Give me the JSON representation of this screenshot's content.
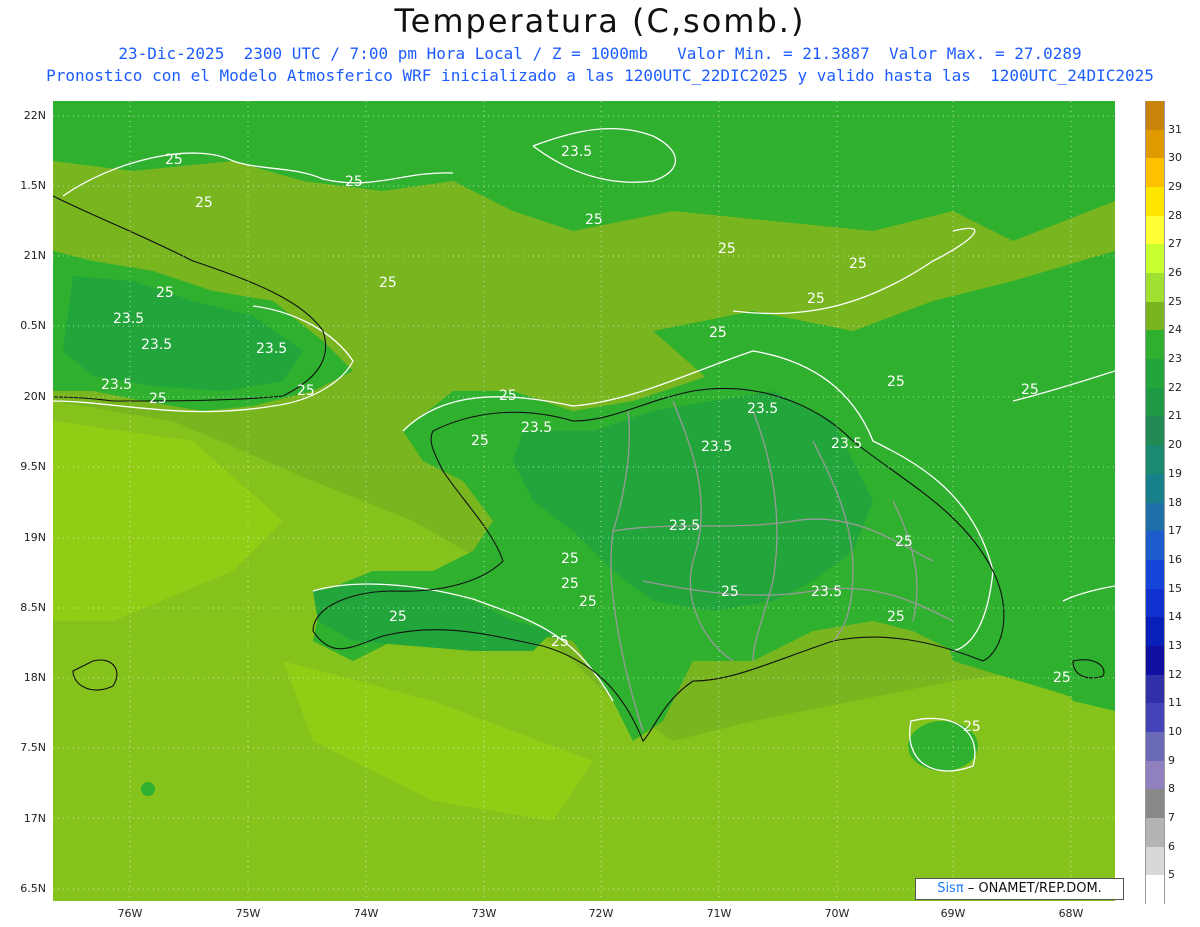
{
  "title": "Temperatura (C,somb.)",
  "subtitle1": "23-Dic-2025  2300 UTC / 7:00 pm Hora Local / Z = 1000mb   Valor Min. = 21.3887  Valor Max. = 27.0289",
  "subtitle2": "Pronostico con el Modelo Atmosferico WRF inicializado a las 1200UTC_22DIC2025 y valido hasta las  1200UTC_24DIC2025",
  "credit": {
    "brand": "Sisπ",
    "text": " – ONAMET/REP.DOM."
  },
  "lat_labels": [
    "22N",
    "1.5N",
    "21N",
    "0.5N",
    "20N",
    "9.5N",
    "19N",
    "8.5N",
    "18N",
    "7.5N",
    "17N",
    "6.5N"
  ],
  "lon_labels": [
    "76W",
    "75W",
    "74W",
    "73W",
    "72W",
    "71W",
    "70W",
    "69W",
    "68W"
  ],
  "contour_labels": [
    "25",
    "23.5"
  ],
  "colorbar": {
    "ticks": [
      "31",
      "30",
      "29",
      "28",
      "27",
      "26",
      "25",
      "24",
      "23",
      "22",
      "21",
      "20",
      "19",
      "18",
      "17",
      "16",
      "15",
      "14",
      "13",
      "12",
      "11",
      "10",
      "9",
      "8",
      "7",
      "6",
      "5"
    ],
    "colors": [
      "#c8830a",
      "#e09a00",
      "#ffc000",
      "#ffe600",
      "#ffff33",
      "#c8ff2e",
      "#a0e030",
      "#78b51e",
      "#2fb02f",
      "#22a53a",
      "#1e9a45",
      "#228b55",
      "#1b8a70",
      "#18808a",
      "#1e6fa8",
      "#1c5ccd",
      "#1444d8",
      "#1030d0",
      "#0820b8",
      "#1010a0",
      "#3030a8",
      "#4444b8",
      "#6a6ab8",
      "#9080c0",
      "#888888",
      "#b4b4b4",
      "#d8d8d8",
      "#ffffff"
    ]
  }
}
